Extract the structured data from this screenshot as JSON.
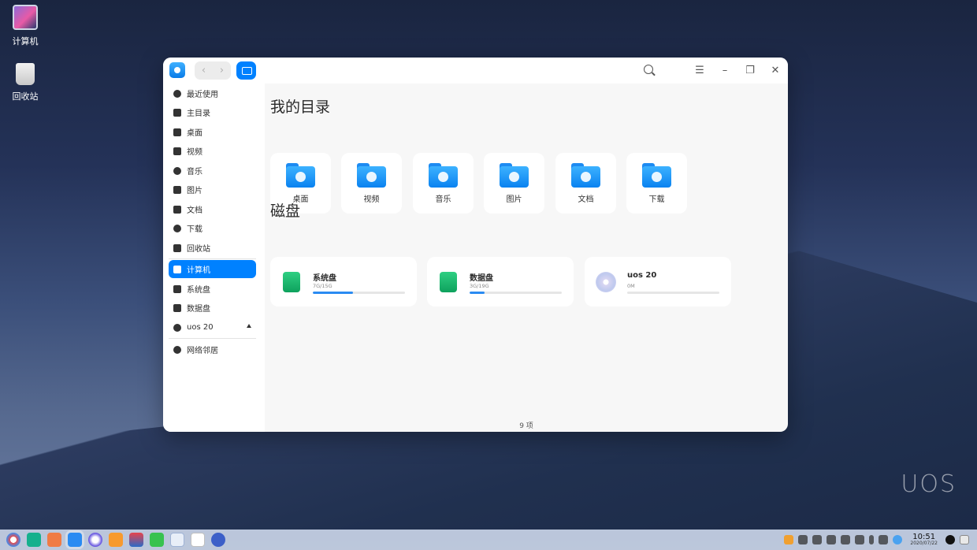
{
  "desktop": {
    "icons": [
      {
        "label": "计算机"
      },
      {
        "label": "回收站"
      }
    ],
    "watermark": "UOS"
  },
  "window": {
    "toolbar": {
      "back": "‹",
      "forward": "›",
      "menu": "☰",
      "minimize": "–",
      "restore": "❐",
      "close": "✕"
    },
    "sidebar": {
      "items": [
        {
          "label": "最近使用",
          "icon": "clock-icon"
        },
        {
          "label": "主目录",
          "icon": "home-icon"
        },
        {
          "label": "桌面",
          "icon": "desktop-icon"
        },
        {
          "label": "视频",
          "icon": "video-icon"
        },
        {
          "label": "音乐",
          "icon": "music-icon"
        },
        {
          "label": "图片",
          "icon": "picture-icon"
        },
        {
          "label": "文档",
          "icon": "document-icon"
        },
        {
          "label": "下载",
          "icon": "download-icon"
        },
        {
          "label": "回收站",
          "icon": "trash-icon"
        },
        {
          "label": "计算机",
          "icon": "computer-icon"
        },
        {
          "label": "系统盘",
          "icon": "disk-icon"
        },
        {
          "label": "数据盘",
          "icon": "disk-icon"
        },
        {
          "label": "uos 20",
          "icon": "disc-icon"
        },
        {
          "label": "网络邻居",
          "icon": "network-icon"
        }
      ]
    },
    "main": {
      "dirs_title": "我的目录",
      "dirs": [
        {
          "label": "桌面"
        },
        {
          "label": "视频"
        },
        {
          "label": "音乐"
        },
        {
          "label": "图片"
        },
        {
          "label": "文档"
        },
        {
          "label": "下载"
        }
      ],
      "disks_title": "磁盘",
      "disks": [
        {
          "name": "系统盘",
          "size": "7G/15G",
          "usage": 0.44
        },
        {
          "name": "数据盘",
          "size": "3G/19G",
          "usage": 0.16
        },
        {
          "name": "uos 20",
          "size": "0M",
          "usage": 0
        }
      ],
      "status": "9 项"
    }
  },
  "taskbar": {
    "time": "10:51",
    "date": "2020/07/22"
  }
}
